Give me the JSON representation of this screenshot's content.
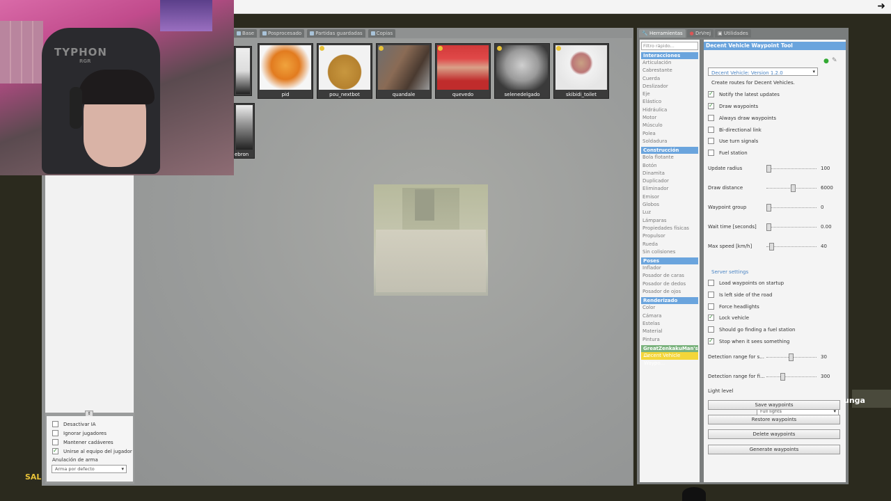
{
  "spawn_tabs": [
    "Base",
    "Posprocesado",
    "Partidas guardadas",
    "Copias"
  ],
  "spawn_icons": [
    "pid",
    "pou_nextbot",
    "quandale",
    "quevedo",
    "selenedelgado",
    "skibidi_toilet"
  ],
  "spawn_partial_label": "ebron",
  "npc_options": [
    {
      "label": "Desactivar IA",
      "checked": false
    },
    {
      "label": "Ignorar jugadores",
      "checked": false
    },
    {
      "label": "Mantener cadáveres",
      "checked": false
    },
    {
      "label": "Unirse al equipo del jugador",
      "checked": true
    }
  ],
  "weapon_override": {
    "label": "Anulación de arma",
    "value": "Arma por defecto"
  },
  "right_tabs": [
    "Herramientas",
    "DrVrej",
    "Utilidades"
  ],
  "tool_filter_placeholder": "Filtro rápido...",
  "tool_categories": [
    {
      "name": "Interacciones",
      "items": [
        "Articulación",
        "Cabrestante",
        "Cuerda",
        "Deslizador",
        "Eje",
        "Elástico",
        "Hidráulica",
        "Motor",
        "Músculo",
        "Polea",
        "Soldadura"
      ]
    },
    {
      "name": "Construcción",
      "items": [
        "Bola flotante",
        "Botón",
        "Dinamita",
        "Duplicador",
        "Eliminador",
        "Emisor",
        "Globos",
        "Luz",
        "Lámparas",
        "Propiedades físicas",
        "Propulsor",
        "Rueda",
        "Sin colisiones"
      ]
    },
    {
      "name": "Poses",
      "items": [
        "Inflador",
        "Posador de caras",
        "Posador de dedos",
        "Posador de ojos"
      ]
    },
    {
      "name": "Renderizado",
      "items": [
        "Color",
        "Cámara",
        "Estelas",
        "Material",
        "Pintura"
      ]
    },
    {
      "name": "GreatZenkakuMan's ...",
      "items": [
        "Decent Vehicle Waypo..."
      ]
    }
  ],
  "tool_panel": {
    "title": "Decent Vehicle Waypoint Tool",
    "version": "Decent Vehicle: Version 1.2.0",
    "description": "Create routes for Decent Vehicles.",
    "checks": [
      {
        "label": "Notify the latest updates",
        "checked": true
      },
      {
        "label": "Draw waypoints",
        "checked": true
      },
      {
        "label": "Always draw waypoints",
        "checked": false
      },
      {
        "label": "Bi-directional link",
        "checked": false
      },
      {
        "label": "Use turn signals",
        "checked": false
      },
      {
        "label": "Fuel station",
        "checked": false
      }
    ],
    "sliders": [
      {
        "label": "Update radius",
        "value": "100",
        "pos": 0.0
      },
      {
        "label": "Draw distance",
        "value": "6000",
        "pos": 0.5
      },
      {
        "label": "Waypoint group",
        "value": "0",
        "pos": 0.0
      },
      {
        "label": "Wait time [seconds]",
        "value": "0.00",
        "pos": 0.0
      },
      {
        "label": "Max speed [km/h]",
        "value": "40",
        "pos": 0.05
      }
    ],
    "server_settings": "Server settings",
    "server_checks": [
      {
        "label": "Load waypoints on startup",
        "checked": false
      },
      {
        "label": "Is left side of the road",
        "checked": false
      },
      {
        "label": "Force headlights",
        "checked": false
      },
      {
        "label": "Lock vehicle",
        "checked": true
      },
      {
        "label": "Should go finding a fuel station",
        "checked": false
      },
      {
        "label": "Stop when it sees something",
        "checked": true
      }
    ],
    "range_sliders": [
      {
        "label": "Detection range for s...",
        "value": "30",
        "pos": 0.45
      },
      {
        "label": "Detection range for fi...",
        "value": "300",
        "pos": 0.28
      }
    ],
    "light_level": {
      "label": "Light level",
      "value": "Full lights"
    },
    "buttons": [
      "Save waypoints",
      "Restore waypoints",
      "Delete waypoints",
      "Generate waypoints"
    ]
  },
  "webcam": {
    "brand": "TYPHON",
    "brand_sub": "RGR"
  },
  "overlay_left": "SAL",
  "overlay_right": "unga"
}
